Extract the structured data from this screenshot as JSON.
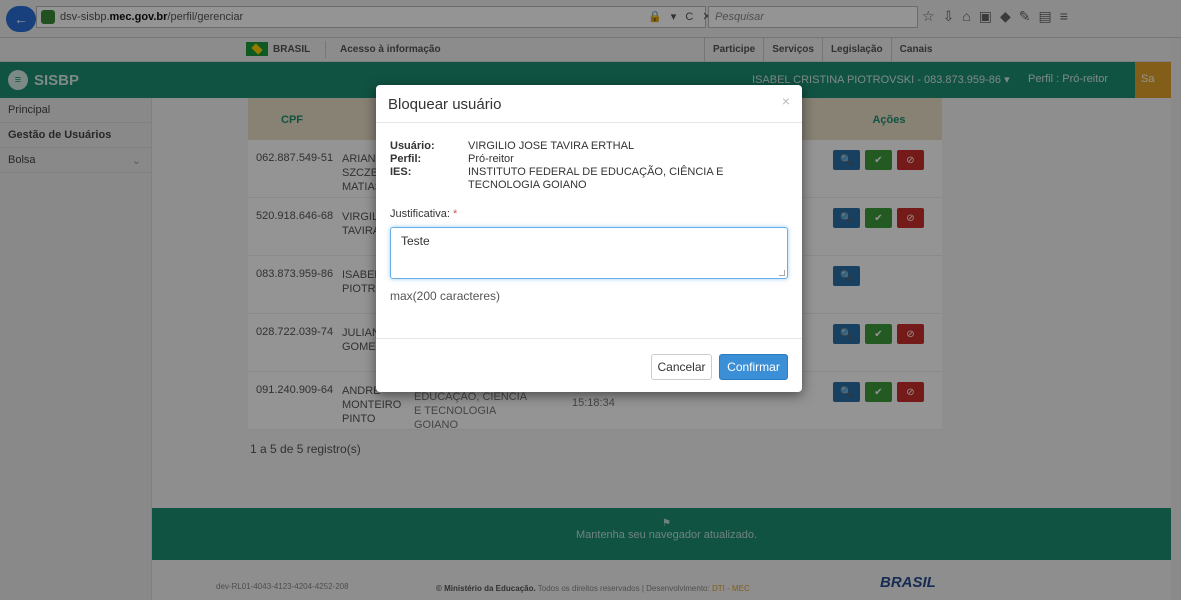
{
  "browser": {
    "url_prefix": "dsv-sisbp.",
    "url_domain": "mec.gov.br",
    "url_path": "/perfil/gerenciar",
    "url_tools": "🔒 ▾ C ✕",
    "search_placeholder": "Pesquisar"
  },
  "govbar": {
    "brasil": "BRASIL",
    "acesso": "Acesso à informação",
    "links": [
      "Participe",
      "Serviços",
      "Legislação",
      "Canais"
    ]
  },
  "header": {
    "app_name": "SISBP",
    "user": "ISABEL CRISTINA PIOTROVSKI - 083.873.959-86 ▾",
    "perfil": "Perfil : Pró-reitor",
    "sair": "Sa"
  },
  "sidebar": {
    "items": [
      {
        "label": "Principal"
      },
      {
        "label": "Gestão de Usuários"
      },
      {
        "label": "Bolsa"
      }
    ]
  },
  "table": {
    "headers": {
      "cpf": "CPF",
      "acoes": "Ações"
    },
    "rows": [
      {
        "cpf": "062.887.549-51",
        "nome": "ARIANE SZCZEP MATIAS"
      },
      {
        "cpf": "520.918.646-68",
        "nome": "VIRGILIO TAVIRA"
      },
      {
        "cpf": "083.873.959-86",
        "nome": "ISABEL PIOTRO"
      },
      {
        "cpf": "028.722.039-74",
        "nome": "JULIANA GOMES"
      },
      {
        "cpf": "091.240.909-64",
        "nome": "ANDRE MONTEIRO PINTO"
      }
    ],
    "extra_ies": "EDUCAÇÃO, CIÊNCIA E TECNOLOGIA GOIANO",
    "extra_time": "15:18:34",
    "count": "1 a 5 de 5 registro(s)"
  },
  "footer": {
    "message": "Mantenha seu navegador atualizado.",
    "version": "dev-RL01-4043-4123-4204-4252-208",
    "copyright_bold": "© Ministério da Educação.",
    "copyright_rest": " Todos os direitos reservados | Desenvolvimento: ",
    "dti": "DTI - MEC",
    "logo": "BRASIL"
  },
  "modal": {
    "title": "Bloquear usuário",
    "close": "×",
    "usuario_label": "Usuário:",
    "usuario_value": "VIRGILIO JOSE TAVIRA ERTHAL",
    "perfil_label": "Perfil:",
    "perfil_value": "Pró-reitor",
    "ies_label": "IES:",
    "ies_value": "INSTITUTO FEDERAL DE EDUCAÇÃO, CIÊNCIA E TECNOLOGIA GOIANO",
    "justificativa_label": "Justificativa:",
    "required_mark": "*",
    "justificativa_value": "Teste",
    "max_chars": "max(200 caracteres)",
    "cancel": "Cancelar",
    "confirm": "Confirmar"
  }
}
